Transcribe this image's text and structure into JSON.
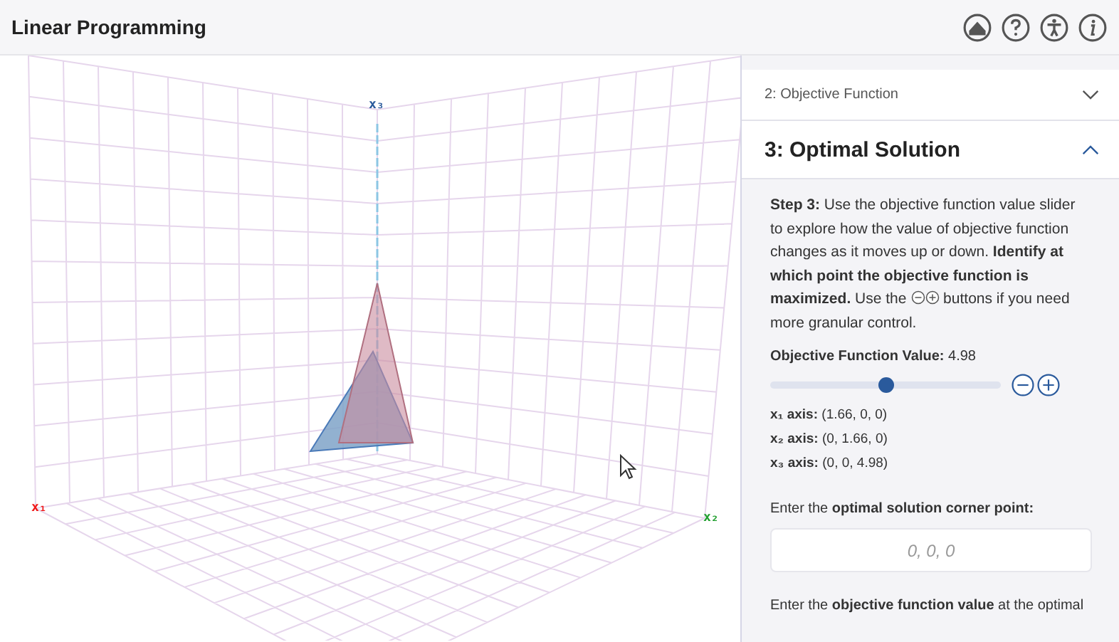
{
  "window": {
    "title": "Linear Programming"
  },
  "scene": {
    "axis_labels": [
      {
        "kind": "x1",
        "text": "x₁"
      },
      {
        "kind": "x2",
        "text": "x₂"
      },
      {
        "kind": "x3",
        "text": "x₃"
      }
    ]
  },
  "sections": [
    {
      "title": "2: Objective Function",
      "expanded": false
    },
    {
      "title": "3: Optimal Solution",
      "expanded": true
    }
  ],
  "step_text": "**Step 3:** Use the objective function value slider to explore how the value of objective function changes as it moves up or down. **Identify at which point the objective function is maximized.** Use the",
  "step_text_after": "buttons if you need more granular control.",
  "slider": {
    "label": "Objective Function Value:",
    "reading": "4.98",
    "level": 0.5
  },
  "axes": [
    {
      "label": "x₁ axis:",
      "value": "(1.66, 0, 0)"
    },
    {
      "label": "x₂ axis:",
      "value": "(0, 1.66, 0)"
    },
    {
      "label": "x₃ axis:",
      "value": "(0, 0, 4.98)"
    }
  ],
  "corner_prompt": "Enter the **optimal solution corner point:**",
  "corner_field": {
    "placeholder": "0, 0, 0"
  },
  "value_prompt": "Enter the **objective function value** at the optimal"
}
